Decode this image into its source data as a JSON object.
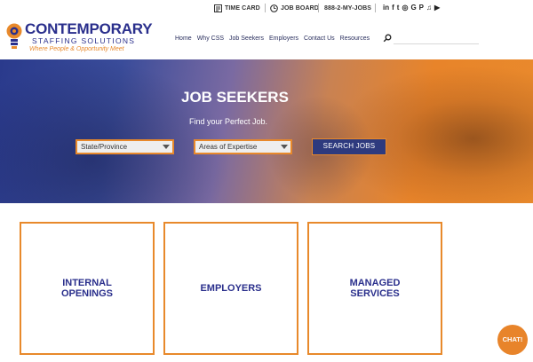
{
  "topbar": {
    "timecard": "TIME CARD",
    "jobboard": "JOB BOARD",
    "phone": "888-2-MY-JOBS",
    "social_icons": [
      "linkedin-icon",
      "facebook-icon",
      "twitter-icon",
      "instagram-icon",
      "google-plus-icon",
      "pinterest-icon",
      "snapchat-icon",
      "youtube-icon"
    ],
    "social_glyphs": [
      "in",
      "f",
      "t",
      "◎",
      "G",
      "P",
      "♫",
      "▶"
    ]
  },
  "logo": {
    "name": "CONTEMPORARY",
    "sub": "STAFFING SOLUTIONS",
    "tagline": "Where People & Opportunity Meet"
  },
  "nav": {
    "items": [
      "Home",
      "Why CSS",
      "Job Seekers",
      "Employers",
      "Contact Us",
      "Resources"
    ]
  },
  "hero": {
    "title": "JOB SEEKERS",
    "subtitle": "Find your Perfect Job.",
    "state_select": "State/Province",
    "expertise_select": "Areas of Expertise",
    "search_button": "SEARCH JOBS"
  },
  "tiles": [
    "INTERNAL\nOPENINGS",
    "EMPLOYERS",
    "MANAGED\nSERVICES"
  ],
  "chat": {
    "label": "CHAT!"
  },
  "colors": {
    "brand_blue": "#2a2f8c",
    "brand_orange": "#e8892b"
  }
}
